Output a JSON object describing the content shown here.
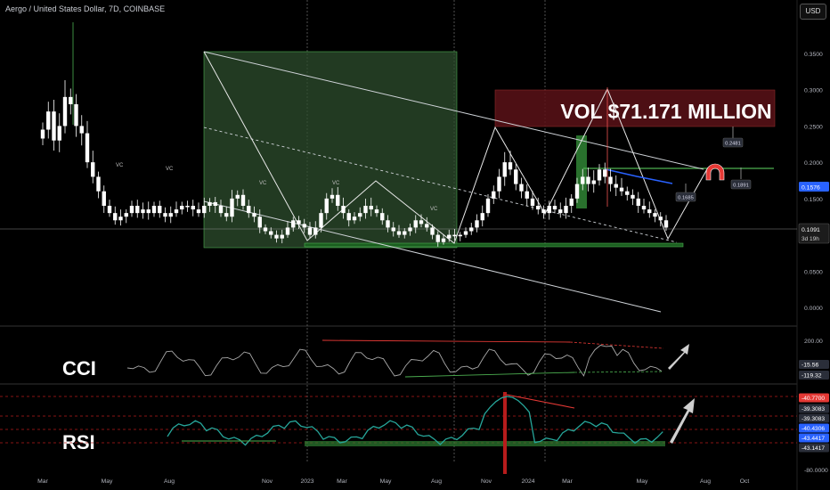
{
  "header": {
    "title": "Aergo / United States Dollar, 7D, COINBASE",
    "currency_button": "USD"
  },
  "colors": {
    "background": "#000000",
    "candle_up": "#ffffff",
    "candle_down": "#ffffff",
    "wick": "#ffffff",
    "green_box": "#2e4d2e",
    "green_line": "#4caf50",
    "red_box": "#5a1218",
    "red_line": "#e53935",
    "blue_label": "#2962ff",
    "gray_axis": "#787b86"
  },
  "chart_data": {
    "type": "candlestick",
    "symbol": "Aergo / United States Dollar",
    "interval": "7D",
    "exchange": "COINBASE",
    "x_labels": [
      "Mar",
      "May",
      "Aug",
      "Nov",
      "2023",
      "Mar",
      "May",
      "Aug",
      "Nov",
      "2024",
      "Mar",
      "May",
      "Aug",
      "Oct"
    ],
    "price_axis": {
      "ticks": [
        "0.3500",
        "0.3000",
        "0.2500",
        "0.2000",
        "0.1500",
        "0.1000",
        "0.0500",
        "0.0000"
      ],
      "range": [
        -0.01,
        0.41
      ]
    },
    "price_labels": {
      "last_price": "0.1091",
      "countdown": "3d 19h",
      "blue_level": "0.1576",
      "callout_1": "0.1685",
      "callout_2": "0.2481",
      "callout_3": "0.1891"
    },
    "annotation_text": "VOL $71.171 MILLION",
    "vc_marker": "VC",
    "cci": {
      "label": "CCI",
      "ticks": [
        "200.00"
      ],
      "values": [
        "-15.56",
        "-119.32"
      ]
    },
    "rsi": {
      "label": "RSI",
      "ticks": [
        "-80.0000"
      ],
      "values": [
        "-40.7700",
        "-39.3083",
        "-39.3083",
        "-40.4306",
        "-43.4417",
        "-43.1417"
      ]
    }
  }
}
